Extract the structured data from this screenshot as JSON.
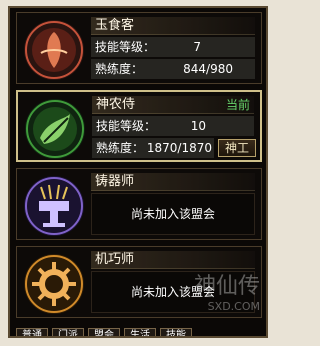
{
  "professions": [
    {
      "name": "玉食客",
      "level_label": "技能等级：",
      "level_value": "7",
      "proficiency_label": "熟练度：",
      "proficiency_value": "844/980",
      "emblem": "culinary-emblem-icon",
      "accent": "#c5523a"
    },
    {
      "name": "神农侍",
      "current_label": "当前",
      "level_label": "技能等级：",
      "level_value": "10",
      "proficiency_label": "熟练度：",
      "proficiency_value": "1870/1870",
      "button_label": "神工",
      "emblem": "herbalist-emblem-icon",
      "accent": "#3f9a3a"
    },
    {
      "name": "铸器师",
      "status": "尚未加入该盟会",
      "emblem": "blacksmith-emblem-icon",
      "accent": "#7f62c9"
    },
    {
      "name": "机巧师",
      "status": "尚未加入该盟会",
      "emblem": "mechanist-emblem-icon",
      "accent": "#d08a2a"
    }
  ],
  "tabs": [
    "普通",
    "门派",
    "盟会",
    "生活",
    "技能"
  ],
  "watermark": {
    "text": "神仙传",
    "url": "SXD.COM"
  }
}
